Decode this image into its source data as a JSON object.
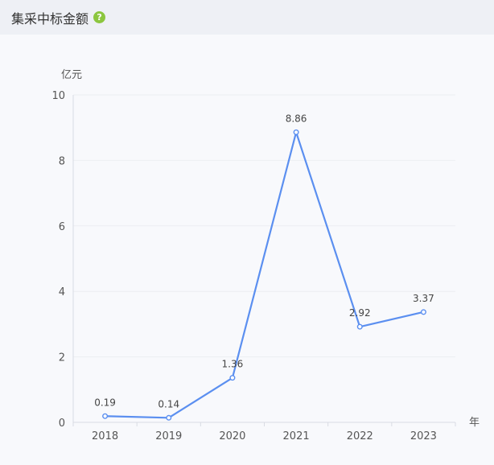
{
  "header": {
    "title": "集采中标金额",
    "help_icon": "question-icon"
  },
  "colors": {
    "line": "#5b8ff0",
    "header_bg": "#eef0f5",
    "plot_bg": "#f8f9fc",
    "help_icon": "#8cc63f"
  },
  "chart_data": {
    "type": "line",
    "categories": [
      "2018",
      "2019",
      "2020",
      "2021",
      "2022",
      "2023"
    ],
    "series": [
      {
        "values": [
          0.19,
          0.14,
          1.36,
          8.86,
          2.92,
          3.37
        ]
      }
    ],
    "data_labels": [
      "0.19",
      "0.14",
      "1.36",
      "8.86",
      "2.92",
      "3.37"
    ],
    "yticks": [
      0,
      2,
      4,
      6,
      8,
      10
    ],
    "ylim": [
      0,
      10
    ],
    "ylabel": "亿元",
    "xlabel": "年",
    "grid": true
  }
}
